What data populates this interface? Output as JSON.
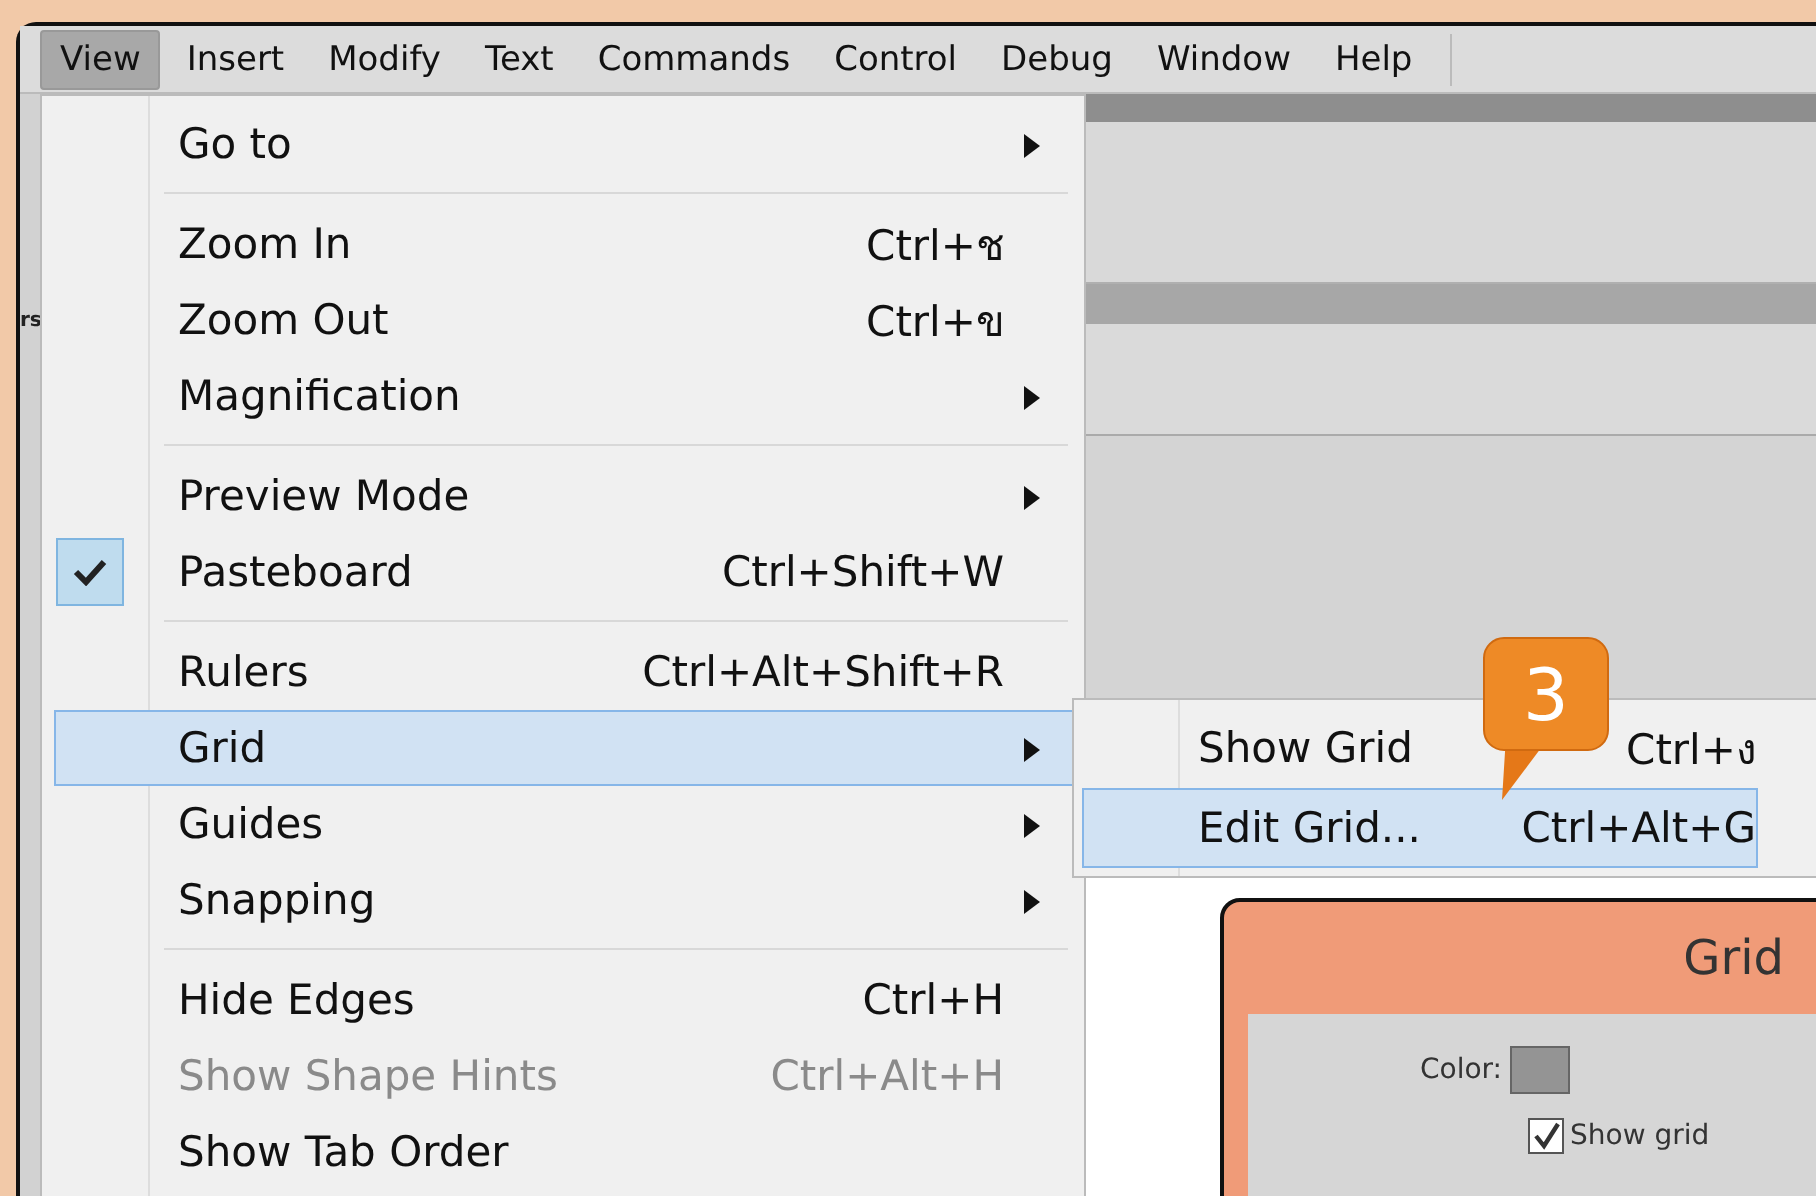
{
  "menubar": [
    {
      "label": "View",
      "selected": true
    },
    {
      "label": "Insert",
      "selected": false
    },
    {
      "label": "Modify",
      "selected": false
    },
    {
      "label": "Text",
      "selected": false
    },
    {
      "label": "Commands",
      "selected": false
    },
    {
      "label": "Control",
      "selected": false
    },
    {
      "label": "Debug",
      "selected": false
    },
    {
      "label": "Window",
      "selected": false
    },
    {
      "label": "Help",
      "selected": false
    }
  ],
  "side_panel_text": "rs",
  "view_menu": [
    [
      {
        "label": "Go to",
        "has_submenu": true,
        "checked": false,
        "disabled": false,
        "selected": false
      }
    ],
    [
      {
        "label": "Zoom In",
        "shortcut": "Ctrl+ช",
        "has_submenu": false,
        "checked": false,
        "disabled": false,
        "selected": false
      },
      {
        "label": "Zoom Out",
        "shortcut": "Ctrl+ข",
        "has_submenu": false,
        "checked": false,
        "disabled": false,
        "selected": false
      },
      {
        "label": "Magnification",
        "has_submenu": true,
        "checked": false,
        "disabled": false,
        "selected": false
      }
    ],
    [
      {
        "label": "Preview Mode",
        "has_submenu": true,
        "checked": false,
        "disabled": false,
        "selected": false
      },
      {
        "label": "Pasteboard",
        "shortcut": "Ctrl+Shift+W",
        "has_submenu": false,
        "checked": true,
        "disabled": false,
        "selected": false
      }
    ],
    [
      {
        "label": "Rulers",
        "shortcut": "Ctrl+Alt+Shift+R",
        "has_submenu": false,
        "checked": false,
        "disabled": false,
        "selected": false
      },
      {
        "label": "Grid",
        "has_submenu": true,
        "checked": false,
        "disabled": false,
        "selected": true
      },
      {
        "label": "Guides",
        "has_submenu": true,
        "checked": false,
        "disabled": false,
        "selected": false
      },
      {
        "label": "Snapping",
        "has_submenu": true,
        "checked": false,
        "disabled": false,
        "selected": false
      }
    ],
    [
      {
        "label": "Hide Edges",
        "shortcut": "Ctrl+H",
        "has_submenu": false,
        "checked": false,
        "disabled": false,
        "selected": false
      },
      {
        "label": "Show Shape Hints",
        "shortcut": "Ctrl+Alt+H",
        "has_submenu": false,
        "checked": false,
        "disabled": true,
        "selected": false
      },
      {
        "label": "Show Tab Order",
        "has_submenu": false,
        "checked": false,
        "disabled": false,
        "selected": false
      }
    ]
  ],
  "grid_submenu": [
    {
      "label": "Show Grid",
      "shortcut": "Ctrl+ง",
      "selected": false
    },
    {
      "label": "Edit Grid...",
      "shortcut": "Ctrl+Alt+G",
      "selected": true
    }
  ],
  "callout": {
    "label": "3"
  },
  "dialog": {
    "title": "Grid",
    "color_label": "Color:",
    "show_grid": {
      "label": "Show grid",
      "checked": true
    }
  }
}
